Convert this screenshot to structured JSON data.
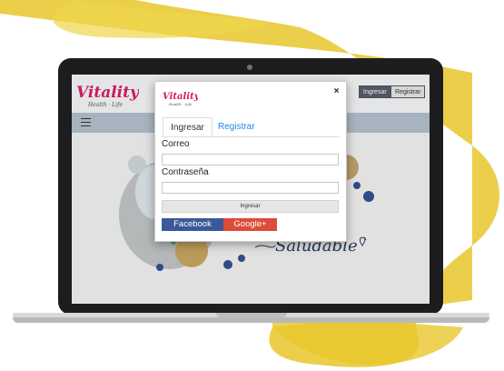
{
  "site": {
    "logo_text": "Vitality",
    "logo_sub": "Health · Life",
    "header_buttons": {
      "ingresar": "Ingresar",
      "registrar": "Registrar"
    },
    "banner_text": "Saludable"
  },
  "modal": {
    "logo_text": "Vitality",
    "logo_sub": "Health · Life",
    "close": "×",
    "tabs": [
      {
        "label": "Ingresar",
        "active": true
      },
      {
        "label": "Registrar",
        "active": false
      }
    ],
    "fields": {
      "email_label": "Correo",
      "email_value": "",
      "password_label": "Contraseña",
      "password_value": ""
    },
    "submit_label": "Ingresar",
    "social": {
      "facebook": "Facebook",
      "google": "Google+"
    }
  },
  "colors": {
    "accent_pink": "#d81b60",
    "link_blue": "#1e88e5",
    "facebook": "#3b5998",
    "google": "#dd4b39",
    "paint_yellow": "#e8c72a"
  }
}
